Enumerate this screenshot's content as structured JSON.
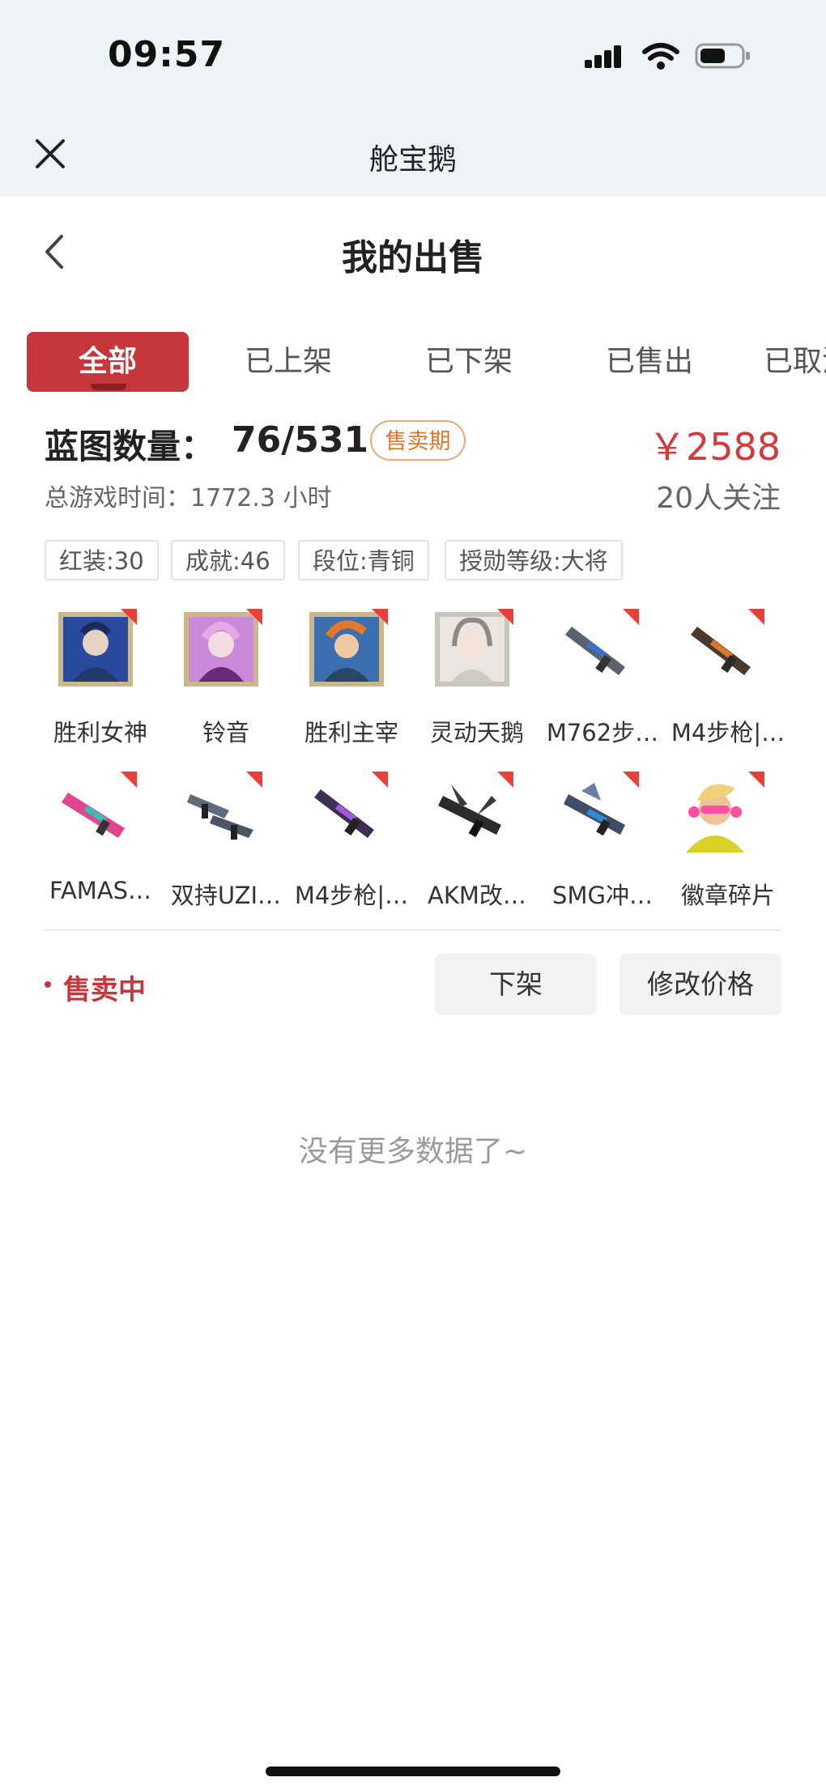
{
  "status_bar": {
    "time": "09:57"
  },
  "app": {
    "title": "舱宝鹅"
  },
  "page": {
    "title": "我的出售"
  },
  "tabs": [
    {
      "label": "全部",
      "active": true
    },
    {
      "label": "已上架",
      "active": false
    },
    {
      "label": "已下架",
      "active": false
    },
    {
      "label": "已售出",
      "active": false
    },
    {
      "label": "已取消",
      "active": false
    }
  ],
  "listing": {
    "blueprint_label": "蓝图数量：",
    "blueprint_count": "76/531",
    "sale_badge": "售卖期",
    "price": "￥2588",
    "playtime": "总游戏时间：1772.3 小时",
    "watchers": "20人关注",
    "tags": [
      "红装:30",
      "成就:46",
      "段位:青铜",
      "授勋等级:大将"
    ],
    "items": [
      {
        "label": "胜利女神",
        "icon": "character-portrait"
      },
      {
        "label": "铃音",
        "icon": "character-portrait"
      },
      {
        "label": "胜利主宰",
        "icon": "character-portrait"
      },
      {
        "label": "灵动天鹅",
        "icon": "character-portrait"
      },
      {
        "label": "M762步…",
        "icon": "rifle-skin"
      },
      {
        "label": "M4步枪|…",
        "icon": "rifle-skin"
      },
      {
        "label": "FAMAS…",
        "icon": "rifle-skin"
      },
      {
        "label": "双持UZI…",
        "icon": "smg-skin"
      },
      {
        "label": "M4步枪|…",
        "icon": "rifle-skin"
      },
      {
        "label": "AKM改…",
        "icon": "rifle-skin"
      },
      {
        "label": "SMG冲…",
        "icon": "smg-skin"
      },
      {
        "label": "徽章碎片",
        "icon": "character-portrait"
      }
    ],
    "status": "售卖中",
    "delist_button": "下架",
    "edit_price_button": "修改价格"
  },
  "footer": {
    "no_more": "没有更多数据了~"
  },
  "colors": {
    "accent": "#c5373a",
    "badge": "#e0772a",
    "price": "#d23b3b"
  }
}
